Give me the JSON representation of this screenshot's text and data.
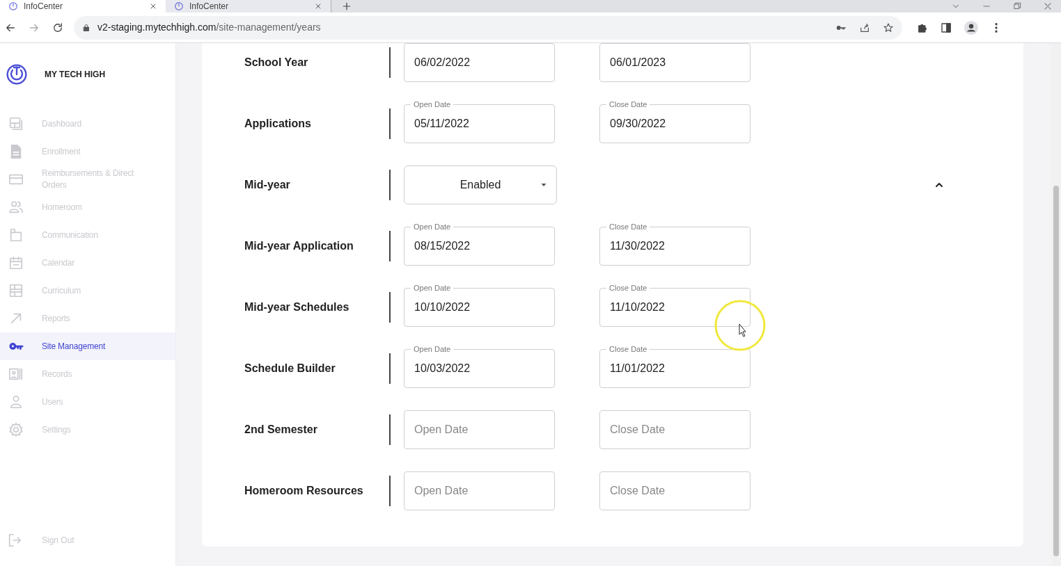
{
  "browser": {
    "tabs": [
      {
        "title": "InfoCenter",
        "selected": true
      },
      {
        "title": "InfoCenter",
        "selected": false
      }
    ],
    "url_host": "v2-staging.mytechhigh.com",
    "url_path": "/site-management/years"
  },
  "sidebar": {
    "brand": "MY TECH HIGH",
    "items": [
      {
        "label": "Dashboard",
        "selected": false
      },
      {
        "label": "Enrollment",
        "selected": false
      },
      {
        "label": "Reimbursements & Direct Orders",
        "selected": false
      },
      {
        "label": "Homeroom",
        "selected": false
      },
      {
        "label": "Communication",
        "selected": false
      },
      {
        "label": "Calendar",
        "selected": false
      },
      {
        "label": "Curriculum",
        "selected": false
      },
      {
        "label": "Reports",
        "selected": false
      },
      {
        "label": "Site Management",
        "selected": true
      },
      {
        "label": "Records",
        "selected": false
      },
      {
        "label": "Users",
        "selected": false
      },
      {
        "label": "Settings",
        "selected": false
      }
    ],
    "sign_out": "Sign Out"
  },
  "rows": [
    {
      "label": "School Year",
      "kind": "dates",
      "fields": [
        {
          "value": "06/02/2022"
        },
        {
          "value": "06/01/2023"
        }
      ]
    },
    {
      "label": "Applications",
      "kind": "dates",
      "fields": [
        {
          "label": "Open Date",
          "value": "05/11/2022"
        },
        {
          "label": "Close Date",
          "value": "09/30/2022"
        }
      ]
    },
    {
      "label": "Mid-year",
      "kind": "select",
      "value": "Enabled",
      "expanded": true
    },
    {
      "label": "Mid-year Application",
      "kind": "dates",
      "fields": [
        {
          "label": "Open Date",
          "value": "08/15/2022"
        },
        {
          "label": "Close Date",
          "value": "11/30/2022"
        }
      ]
    },
    {
      "label": "Mid-year Schedules",
      "kind": "dates",
      "fields": [
        {
          "label": "Open Date",
          "value": "10/10/2022"
        },
        {
          "label": "Close Date",
          "value": "11/10/2022"
        }
      ]
    },
    {
      "label": "Schedule Builder",
      "kind": "dates",
      "fields": [
        {
          "label": "Open Date",
          "value": "10/03/2022"
        },
        {
          "label": "Close Date",
          "value": "11/01/2022"
        }
      ]
    },
    {
      "label": "2nd Semester",
      "kind": "dates",
      "fields": [
        {
          "placeholder": "Open Date"
        },
        {
          "placeholder": "Close Date"
        }
      ]
    },
    {
      "label": "Homeroom Resources",
      "kind": "dates",
      "fields": [
        {
          "placeholder": "Open Date"
        },
        {
          "placeholder": "Close Date"
        }
      ]
    }
  ]
}
